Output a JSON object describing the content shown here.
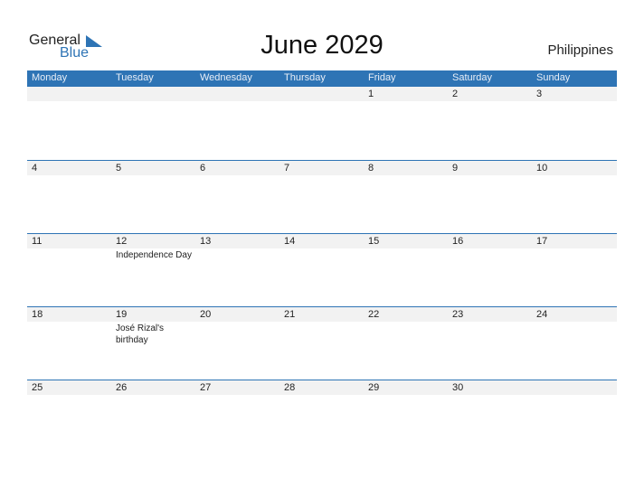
{
  "logo": {
    "general": "General",
    "blue": "Blue"
  },
  "title": "June 2029",
  "country": "Philippines",
  "weekdays": [
    "Monday",
    "Tuesday",
    "Wednesday",
    "Thursday",
    "Friday",
    "Saturday",
    "Sunday"
  ],
  "weeks": [
    [
      {
        "day": ""
      },
      {
        "day": ""
      },
      {
        "day": ""
      },
      {
        "day": ""
      },
      {
        "day": "1"
      },
      {
        "day": "2"
      },
      {
        "day": "3"
      }
    ],
    [
      {
        "day": "4"
      },
      {
        "day": "5"
      },
      {
        "day": "6"
      },
      {
        "day": "7"
      },
      {
        "day": "8"
      },
      {
        "day": "9"
      },
      {
        "day": "10"
      }
    ],
    [
      {
        "day": "11"
      },
      {
        "day": "12",
        "event": "Independence Day"
      },
      {
        "day": "13"
      },
      {
        "day": "14"
      },
      {
        "day": "15"
      },
      {
        "day": "16"
      },
      {
        "day": "17"
      }
    ],
    [
      {
        "day": "18"
      },
      {
        "day": "19",
        "event": "José Rizal's birthday"
      },
      {
        "day": "20"
      },
      {
        "day": "21"
      },
      {
        "day": "22"
      },
      {
        "day": "23"
      },
      {
        "day": "24"
      }
    ],
    [
      {
        "day": "25"
      },
      {
        "day": "26"
      },
      {
        "day": "27"
      },
      {
        "day": "28"
      },
      {
        "day": "29"
      },
      {
        "day": "30"
      },
      {
        "day": ""
      }
    ]
  ],
  "colors": {
    "accent": "#2e74b5",
    "strip": "#f2f2f2"
  }
}
